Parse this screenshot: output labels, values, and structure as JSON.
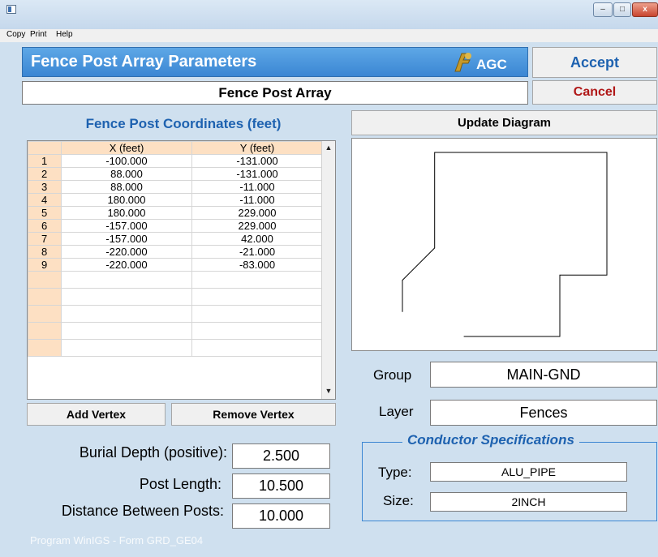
{
  "window": {
    "min_glyph": "–",
    "max_glyph": "□",
    "close_glyph": "x"
  },
  "menu": [
    "Copy",
    "Print",
    "Help"
  ],
  "header": {
    "title": "Fence Post Array Parameters",
    "logo_text": "AGC"
  },
  "buttons": {
    "accept": "Accept",
    "cancel": "Cancel",
    "add_vertex": "Add Vertex",
    "remove_vertex": "Remove Vertex",
    "update_diagram": "Update Diagram"
  },
  "name_value": "Fence Post Array",
  "coords": {
    "title": "Fence Post Coordinates (feet)",
    "columns": [
      "",
      "X (feet)",
      "Y (feet)"
    ],
    "rows": [
      [
        "1",
        "-100.000",
        "-131.000"
      ],
      [
        "2",
        "88.000",
        "-131.000"
      ],
      [
        "3",
        "88.000",
        "-11.000"
      ],
      [
        "4",
        "180.000",
        "-11.000"
      ],
      [
        "5",
        "180.000",
        "229.000"
      ],
      [
        "6",
        "-157.000",
        "229.000"
      ],
      [
        "7",
        "-157.000",
        "42.000"
      ],
      [
        "8",
        "-220.000",
        "-21.000"
      ],
      [
        "9",
        "-220.000",
        "-83.000"
      ]
    ],
    "empty_rows": 5
  },
  "params": {
    "burial_label": "Burial Depth (positive):",
    "burial_value": "2.500",
    "post_length_label": "Post Length:",
    "post_length_value": "10.500",
    "distance_label": "Distance Between Posts:",
    "distance_value": "10.000"
  },
  "group": {
    "label": "Group",
    "value": "MAIN-GND"
  },
  "layer": {
    "label": "Layer",
    "value": "Fences"
  },
  "conductor": {
    "title": "Conductor Specifications",
    "type_label": "Type:",
    "type_value": "ALU_PIPE",
    "size_label": "Size:",
    "size_value": "2INCH"
  },
  "footer": "Program WinIGS - Form GRD_GE04",
  "colors": {
    "accent_blue": "#1e62b0",
    "cancel_red": "#b01717",
    "header_blue": "#3b86d3",
    "row_header_peach": "#fde0c3",
    "background": "#cfe0ef"
  }
}
